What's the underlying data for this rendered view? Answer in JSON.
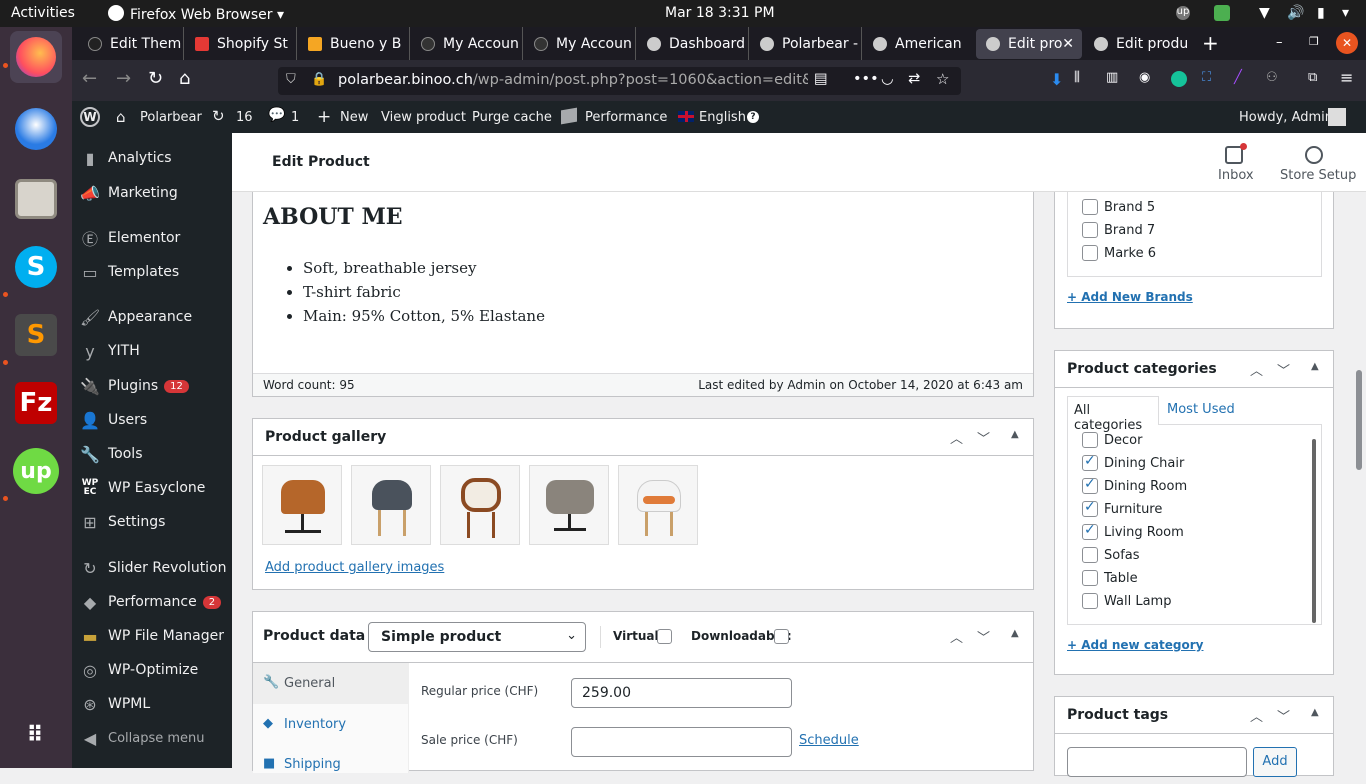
{
  "os": {
    "activities": "Activities",
    "app": "Firefox Web Browser",
    "datetime": "Mar 18  3:31 PM"
  },
  "browser": {
    "tabs": [
      {
        "label": "Edit Them"
      },
      {
        "label": "Shopify St"
      },
      {
        "label": "Bueno y B"
      },
      {
        "label": "My Accoun"
      },
      {
        "label": "My Accoun"
      },
      {
        "label": "Dashboard"
      },
      {
        "label": "Polarbear -"
      },
      {
        "label": "American"
      },
      {
        "label": "Edit pro"
      },
      {
        "label": "Edit produ"
      }
    ],
    "url_host": "polarbear.binoo.ch",
    "url_path": "/wp-admin/post.php?post=1060&action=edit&la"
  },
  "adminbar": {
    "site": "Polarbear",
    "updates": "16",
    "comments": "1",
    "new": "New",
    "view": "View product",
    "purge": "Purge cache",
    "performance": "Performance",
    "language": "English",
    "howdy": "Howdy, Admin"
  },
  "sidebar": {
    "items": [
      {
        "label": "Analytics",
        "icon": "chart-icon"
      },
      {
        "label": "Marketing",
        "icon": "megaphone-icon"
      },
      {
        "label": "Elementor",
        "icon": "elementor-icon"
      },
      {
        "label": "Templates",
        "icon": "folder-icon"
      },
      {
        "label": "Appearance",
        "icon": "brush-icon"
      },
      {
        "label": "YITH",
        "icon": "yith-icon"
      },
      {
        "label": "Plugins",
        "icon": "plug-icon",
        "badge": "12"
      },
      {
        "label": "Users",
        "icon": "user-icon"
      },
      {
        "label": "Tools",
        "icon": "wrench-icon"
      },
      {
        "label": "WP Easyclone",
        "icon": "wpec-icon"
      },
      {
        "label": "Settings",
        "icon": "settings-icon"
      },
      {
        "label": "Slider Revolution",
        "icon": "refresh-icon"
      },
      {
        "label": "Performance",
        "icon": "performance-icon",
        "badge": "2"
      },
      {
        "label": "WP File Manager",
        "icon": "folder-icon"
      },
      {
        "label": "WP-Optimize",
        "icon": "optimize-icon"
      },
      {
        "label": "WPML",
        "icon": "wpml-icon"
      },
      {
        "label": "Collapse menu",
        "icon": "collapse-icon"
      }
    ]
  },
  "header": {
    "title": "Edit Product",
    "inbox": "Inbox",
    "setup": "Store Setup"
  },
  "content": {
    "heading": "ABOUT ME",
    "bullets": [
      "Soft, breathable jersey",
      "T-shirt fabric",
      "Main: 95% Cotton, 5% Elastane"
    ],
    "word_count": "Word count: 95",
    "last_edited": "Last edited by Admin on October 14, 2020 at 6:43 am"
  },
  "gallery": {
    "title": "Product gallery",
    "add_link": "Add product gallery images"
  },
  "product_data": {
    "title": "Product data —",
    "type": "Simple product",
    "virtual": "Virtual:",
    "downloadable": "Downloadable:",
    "tabs": [
      "General",
      "Inventory",
      "Shipping"
    ],
    "regular_label": "Regular price (CHF)",
    "regular_value": "259.00",
    "sale_label": "Sale price (CHF)",
    "sale_value": "",
    "schedule": "Schedule"
  },
  "brands": {
    "items": [
      {
        "label": "Brand 5",
        "checked": false
      },
      {
        "label": "Brand 7",
        "checked": false
      },
      {
        "label": "Marke 6",
        "checked": false
      }
    ],
    "add": "+ Add New Brands"
  },
  "categories": {
    "title": "Product categories",
    "tab_all": "All categories",
    "tab_used": "Most Used",
    "items": [
      {
        "label": "Decor",
        "checked": false
      },
      {
        "label": "Dining Chair",
        "checked": true
      },
      {
        "label": "Dining Room",
        "checked": true
      },
      {
        "label": "Furniture",
        "checked": true
      },
      {
        "label": "Living Room",
        "checked": true
      },
      {
        "label": "Sofas",
        "checked": false
      },
      {
        "label": "Table",
        "checked": false
      },
      {
        "label": "Wall Lamp",
        "checked": false
      }
    ],
    "add": "+ Add new category"
  },
  "tags": {
    "title": "Product tags",
    "add": "Add"
  }
}
